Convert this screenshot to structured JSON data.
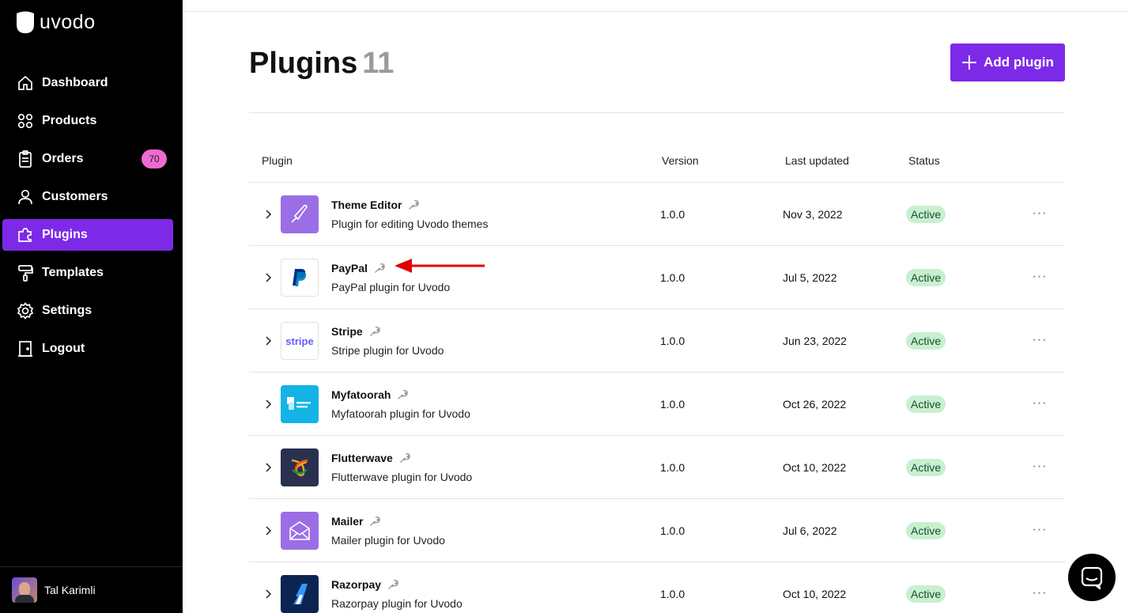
{
  "brand": {
    "name": "uvodo"
  },
  "sidebar": {
    "items": [
      {
        "label": "Dashboard",
        "icon": "home-icon",
        "active": false
      },
      {
        "label": "Products",
        "icon": "grid-icon",
        "active": false
      },
      {
        "label": "Orders",
        "icon": "clipboard-icon",
        "active": false,
        "badge": "70"
      },
      {
        "label": "Customers",
        "icon": "user-icon",
        "active": false
      },
      {
        "label": "Plugins",
        "icon": "puzzle-icon",
        "active": true
      },
      {
        "label": "Templates",
        "icon": "paint-roller-icon",
        "active": false
      },
      {
        "label": "Settings",
        "icon": "gear-icon",
        "active": false
      },
      {
        "label": "Logout",
        "icon": "door-icon",
        "active": false
      }
    ],
    "user": {
      "name": "Tal Karimli"
    }
  },
  "page": {
    "title": "Plugins",
    "count": "11",
    "add_button": "Add plugin"
  },
  "table": {
    "headers": {
      "plugin": "Plugin",
      "version": "Version",
      "updated": "Last updated",
      "status": "Status"
    },
    "rows": [
      {
        "name": "Theme Editor",
        "desc": "Plugin for editing Uvodo themes",
        "version": "1.0.0",
        "updated": "Nov 3, 2022",
        "status": "Active",
        "logo": "theme-editor-logo"
      },
      {
        "name": "PayPal",
        "desc": "PayPal plugin for Uvodo",
        "version": "1.0.0",
        "updated": "Jul 5, 2022",
        "status": "Active",
        "logo": "paypal-logo"
      },
      {
        "name": "Stripe",
        "desc": "Stripe plugin for Uvodo",
        "version": "1.0.0",
        "updated": "Jun 23, 2022",
        "status": "Active",
        "logo": "stripe-logo",
        "logo_text": "stripe"
      },
      {
        "name": "Myfatoorah",
        "desc": "Myfatoorah plugin for Uvodo",
        "version": "1.0.0",
        "updated": "Oct 26, 2022",
        "status": "Active",
        "logo": "myfatoorah-logo"
      },
      {
        "name": "Flutterwave",
        "desc": "Flutterwave plugin for Uvodo",
        "version": "1.0.0",
        "updated": "Oct 10, 2022",
        "status": "Active",
        "logo": "flutterwave-logo"
      },
      {
        "name": "Mailer",
        "desc": "Mailer plugin for Uvodo",
        "version": "1.0.0",
        "updated": "Jul 6, 2022",
        "status": "Active",
        "logo": "mailer-logo"
      },
      {
        "name": "Razorpay",
        "desc": "Razorpay plugin for Uvodo",
        "version": "1.0.0",
        "updated": "Oct 10, 2022",
        "status": "Active",
        "logo": "razorpay-logo"
      }
    ]
  },
  "colors": {
    "accent": "#7d2ae8",
    "badge": "#f06ad2",
    "status_bg": "#c7f0d0",
    "annotation_arrow": "#e00000"
  }
}
